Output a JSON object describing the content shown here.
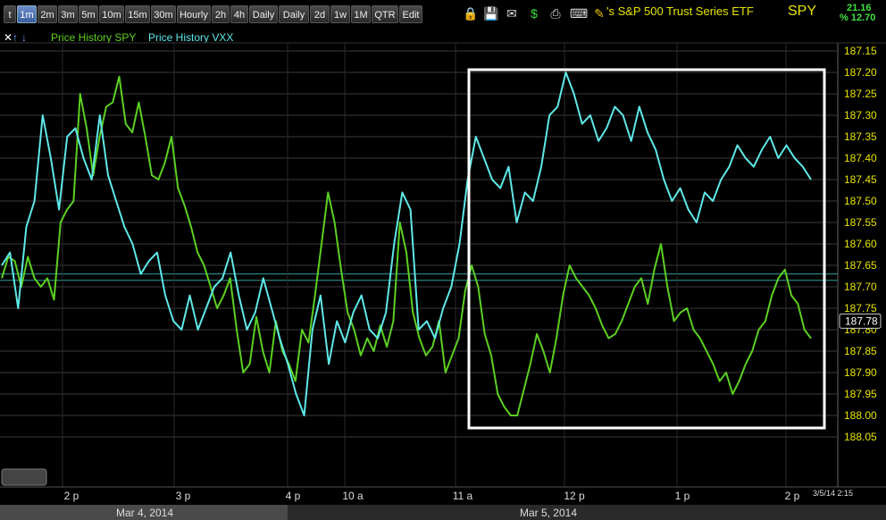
{
  "toolbar": {
    "tabs": [
      {
        "label": "t",
        "active": false
      },
      {
        "label": "1m",
        "active": true
      },
      {
        "label": "2m",
        "active": false
      },
      {
        "label": "3m",
        "active": false
      },
      {
        "label": "5m",
        "active": false
      },
      {
        "label": "10m",
        "active": false
      },
      {
        "label": "15m",
        "active": false
      },
      {
        "label": "30m",
        "active": false
      },
      {
        "label": "Hourly",
        "active": false
      },
      {
        "label": "2h",
        "active": false
      },
      {
        "label": "4h",
        "active": false
      },
      {
        "label": "Daily",
        "active": false
      },
      {
        "label": "Daily",
        "active": false
      },
      {
        "label": "2d",
        "active": false
      },
      {
        "label": "1w",
        "active": false
      },
      {
        "label": "1M",
        "active": false
      },
      {
        "label": "QTR",
        "active": false
      },
      {
        "label": "Edit",
        "active": false
      }
    ],
    "icons": [
      "lock-icon",
      "save-icon",
      "mail-icon",
      "dollar-icon",
      "print-icon",
      "keyboard-icon",
      "pencil-icon"
    ],
    "title": "'s S&P 500 Trust Series ETF",
    "symbol": "SPY",
    "change_top": "21.16",
    "change_bottom": "% 12.70"
  },
  "legend": {
    "controls": [
      "close-icon",
      "up-arrow-icon",
      "down-arrow-icon"
    ],
    "items": [
      {
        "label": "Price History SPY",
        "color": "#5cd021"
      },
      {
        "label": "Price History VXX",
        "color": "#5fe8e8"
      }
    ]
  },
  "colors": {
    "spy": "#5cd021",
    "vxx": "#5fe8e8",
    "grid": "#3a3a3a",
    "box": "#ffffff",
    "axis_text": "#e8e400"
  },
  "chart_data": {
    "type": "line",
    "y_axis": {
      "ticks": [
        "187.15",
        "187.20",
        "187.25",
        "187.30",
        "187.35",
        "187.40",
        "187.45",
        "187.50",
        "187.55",
        "187.60",
        "187.65",
        "187.70",
        "187.75",
        "187.80",
        "187.85",
        "187.90",
        "187.95",
        "188.00",
        "188.05"
      ],
      "range": [
        187.15,
        188.05
      ],
      "inverted": true,
      "last_value_label": "187.78"
    },
    "x_axis": {
      "ticks": [
        "2 p",
        "3 p",
        "4 p",
        "10 a",
        "11 a",
        "12 p",
        "1 p",
        "2 p"
      ],
      "dates": [
        "Mar 4, 2014",
        "Mar 5, 2014"
      ],
      "timestamp": "3/5/14 2:15"
    },
    "series": [
      {
        "name": "Price History SPY",
        "color": "#5cd021",
        "values": [
          187.68,
          187.63,
          187.64,
          187.7,
          187.63,
          187.68,
          187.7,
          187.68,
          187.73,
          187.55,
          187.52,
          187.5,
          187.25,
          187.33,
          187.44,
          187.35,
          187.28,
          187.27,
          187.21,
          187.32,
          187.34,
          187.27,
          187.35,
          187.44,
          187.45,
          187.41,
          187.35,
          187.47,
          187.51,
          187.56,
          187.62,
          187.65,
          187.7,
          187.75,
          187.72,
          187.68,
          187.8,
          187.9,
          187.88,
          187.77,
          187.85,
          187.9,
          187.78,
          187.85,
          187.88,
          187.92,
          187.8,
          187.83,
          187.72,
          187.6,
          187.48,
          187.55,
          187.66,
          187.76,
          187.8,
          187.86,
          187.82,
          187.85,
          187.79,
          187.84,
          187.78,
          187.55,
          187.62,
          187.76,
          187.82,
          187.86,
          187.84,
          187.78,
          187.9,
          187.86,
          187.82,
          187.71,
          187.65,
          187.7,
          187.81,
          187.86,
          187.95,
          187.98,
          188.0,
          188.0,
          187.94,
          187.88,
          187.81,
          187.85,
          187.9,
          187.82,
          187.72,
          187.65,
          187.68,
          187.7,
          187.72,
          187.75,
          187.79,
          187.82,
          187.81,
          187.78,
          187.74,
          187.7,
          187.68,
          187.74,
          187.66,
          187.6,
          187.7,
          187.78,
          187.76,
          187.75,
          187.8,
          187.82,
          187.85,
          187.88,
          187.92,
          187.9,
          187.95,
          187.92,
          187.88,
          187.85,
          187.8,
          187.78,
          187.72,
          187.68,
          187.66,
          187.72,
          187.74,
          187.8,
          187.82
        ]
      },
      {
        "name": "Price History VXX",
        "color": "#5fe8e8",
        "values": [
          187.65,
          187.62,
          187.75,
          187.56,
          187.5,
          187.3,
          187.4,
          187.52,
          187.35,
          187.33,
          187.4,
          187.45,
          187.3,
          187.44,
          187.5,
          187.56,
          187.6,
          187.67,
          187.64,
          187.62,
          187.72,
          187.78,
          187.8,
          187.72,
          187.8,
          187.75,
          187.7,
          187.68,
          187.62,
          187.72,
          187.8,
          187.76,
          187.68,
          187.75,
          187.82,
          187.88,
          187.95,
          188.0,
          187.8,
          187.72,
          187.88,
          187.78,
          187.83,
          187.76,
          187.72,
          187.8,
          187.82,
          187.76,
          187.6,
          187.48,
          187.52,
          187.8,
          187.78,
          187.82,
          187.75,
          187.7,
          187.6,
          187.45,
          187.35,
          187.4,
          187.45,
          187.47,
          187.42,
          187.55,
          187.48,
          187.5,
          187.42,
          187.3,
          187.28,
          187.2,
          187.25,
          187.32,
          187.3,
          187.36,
          187.33,
          187.28,
          187.3,
          187.36,
          187.28,
          187.34,
          187.38,
          187.45,
          187.5,
          187.47,
          187.52,
          187.55,
          187.48,
          187.5,
          187.45,
          187.42,
          187.37,
          187.4,
          187.42,
          187.38,
          187.35,
          187.4,
          187.37,
          187.4,
          187.42,
          187.45
        ]
      }
    ]
  }
}
